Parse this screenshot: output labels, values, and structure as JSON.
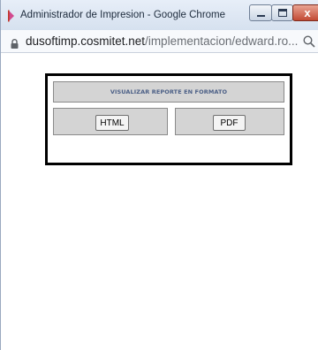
{
  "window": {
    "title": "Administrador de Impresion - Google Chrome",
    "close_label": "x"
  },
  "address": {
    "domain": "dusoftimp.cosmitet.net",
    "path": "/implementacion/edward.ro..."
  },
  "report": {
    "header": "VISUALIZAR REPORTE EN FORMATO",
    "html_label": "HTML",
    "pdf_label": "PDF"
  },
  "colors": {
    "header_text": "#4b5f86",
    "panel_gray": "#d4d4d4",
    "close_button": "#c24a34"
  },
  "icons": {
    "app": "chrome-app-icon",
    "lock": "lock-icon",
    "zoom": "zoom-icon"
  }
}
